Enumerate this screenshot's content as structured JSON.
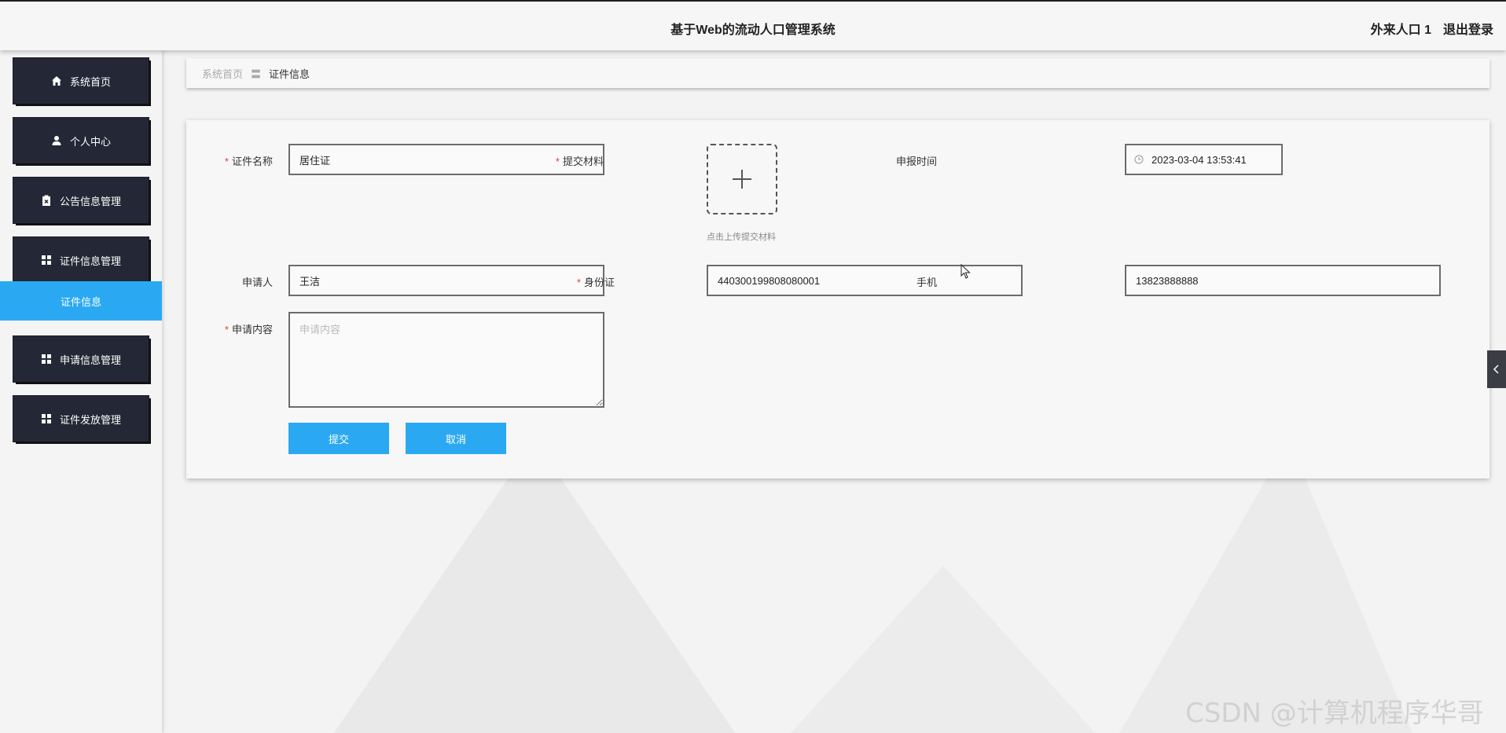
{
  "header": {
    "title": "基于Web的流动人口管理系统",
    "user": "外来人口 1",
    "logout": "退出登录"
  },
  "sidebar": {
    "items": [
      {
        "label": "系统首页",
        "icon": "home-icon"
      },
      {
        "label": "个人中心",
        "icon": "user-icon"
      },
      {
        "label": "公告信息管理",
        "icon": "clipboard-icon"
      },
      {
        "label": "证件信息管理",
        "icon": "grid-icon"
      },
      {
        "label": "申请信息管理",
        "icon": "grid-icon"
      },
      {
        "label": "证件发放管理",
        "icon": "grid-icon"
      }
    ],
    "active_sub": "证件信息"
  },
  "breadcrumb": {
    "home": "系统首页",
    "separator": "〓",
    "current": "证件信息"
  },
  "form": {
    "cert_name": {
      "label": "证件名称",
      "value": "居住证",
      "required": true
    },
    "materials": {
      "label": "提交材料",
      "tip": "点击上传提交材料",
      "required": true
    },
    "report_time": {
      "label": "申报时间",
      "value": "2023-03-04 13:53:41"
    },
    "applicant": {
      "label": "申请人",
      "value": "王洁"
    },
    "id_card": {
      "label": "身份证",
      "value": "440300199808080001",
      "required": true
    },
    "phone": {
      "label": "手机",
      "value": "13823888888"
    },
    "content": {
      "label": "申请内容",
      "placeholder": "申请内容",
      "value": "",
      "required": true
    },
    "submit": "提交",
    "cancel": "取消"
  },
  "watermark": "CSDN @计算机程序华哥",
  "colors": {
    "accent": "#2aa9f2",
    "sidebar_button": "#242836",
    "required": "#e04040"
  }
}
